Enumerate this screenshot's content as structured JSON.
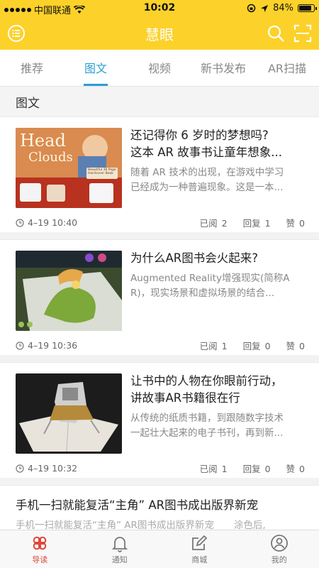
{
  "status": {
    "carrier": "中国联通",
    "time": "10:02",
    "battery": "84%",
    "battery_level": 0.84
  },
  "appbar": {
    "title": "慧眼"
  },
  "tabs": [
    "推荐",
    "图文",
    "视频",
    "新书发布",
    "AR扫描"
  ],
  "active_tab": 1,
  "section_title": "图文",
  "labels": {
    "read": "已阅",
    "reply": "回复",
    "like": "赞"
  },
  "articles": [
    {
      "title": [
        "还记得你 6 岁时的梦想吗?",
        "这本 AR 故事书让童年想象..."
      ],
      "desc": [
        "随着 AR 技术的出现，在游戏中学习",
        "已经成为一种普遍现象。这是一本..."
      ],
      "date": "4–19 10:40",
      "read": "2",
      "reply": "1",
      "like": "0",
      "thumb_text": {
        "head": "Head",
        "clouds": "Clouds",
        "badge": "Beautiful 36 Page Hardcover Book"
      }
    },
    {
      "title": [
        "为什么AR图书会火起来?"
      ],
      "desc": [
        "Augmented Reality增强现实(简称A",
        "R)，现实场景和虚拟场景的结合..."
      ],
      "date": "4–19 10:36",
      "read": "1",
      "reply": "0",
      "like": "0"
    },
    {
      "title": [
        "让书中的人物在你眼前行动，",
        "讲故事AR书籍很在行"
      ],
      "desc": [
        "从传统的纸质书籍，到跟随数字技术",
        "一起壮大起来的电子书刊，再到新..."
      ],
      "date": "4–19 10:32",
      "read": "1",
      "reply": "0",
      "like": "0"
    }
  ],
  "partial_article": {
    "title": "手机一扫就能复活“主角” AR图书成出版界新宠",
    "desc": "手机一扫就能复活“主角” AR图书成出版界新宠",
    "desc_tail": "涂色后,"
  },
  "bottom_nav": [
    "导读",
    "通知",
    "商城",
    "我的"
  ],
  "colors": {
    "brand": "#fcd12a",
    "accent": "#2a9fd6",
    "active_nav": "#e0473a"
  }
}
